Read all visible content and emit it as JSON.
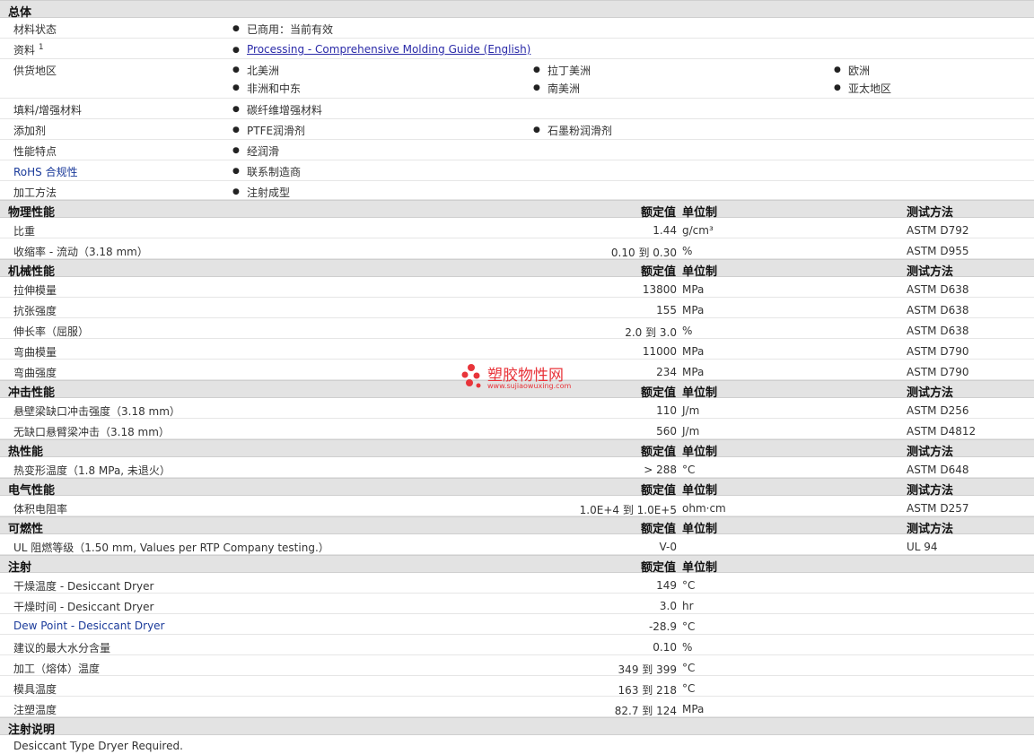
{
  "general": {
    "title": "总体",
    "material_status": {
      "label": "材料状态",
      "value": "已商用：当前有效"
    },
    "literature": {
      "label": "资料",
      "sup": "1",
      "link": "Processing - Comprehensive Molding Guide (English)"
    },
    "availability": {
      "label": "供货地区",
      "items": [
        "北美洲",
        "拉丁美洲",
        "欧洲",
        "非洲和中东",
        "南美洲",
        "亚太地区"
      ]
    },
    "filler": {
      "label": "填料/增强材料",
      "value": "碳纤维增强材料"
    },
    "additive": {
      "label": "添加剂",
      "items": [
        "PTFE润滑剂",
        "石墨粉润滑剂"
      ]
    },
    "features": {
      "label": "性能特点",
      "value": "经润滑"
    },
    "rohs": {
      "label": "RoHS 合规性",
      "value": "联系制造商"
    },
    "processing": {
      "label": "加工方法",
      "value": "注射成型"
    }
  },
  "columns": {
    "nominal": "额定值",
    "unit": "单位制",
    "test": "测试方法"
  },
  "sections": {
    "physical": {
      "title": "物理性能",
      "rows": [
        {
          "label": "比重",
          "value": "1.44",
          "unit": "g/cm³",
          "test": "ASTM D792"
        },
        {
          "label": "收缩率  - 流动（3.18 mm）",
          "value": "0.10 到  0.30",
          "unit": "%",
          "test": "ASTM D955"
        }
      ]
    },
    "mechanical": {
      "title": "机械性能",
      "rows": [
        {
          "label": "拉伸模量",
          "value": "13800",
          "unit": "MPa",
          "test": "ASTM D638"
        },
        {
          "label": "抗张强度",
          "value": "155",
          "unit": "MPa",
          "test": "ASTM D638"
        },
        {
          "label": "伸长率（屈服）",
          "value": "2.0 到  3.0",
          "unit": "%",
          "test": "ASTM D638"
        },
        {
          "label": "弯曲模量",
          "value": "11000",
          "unit": "MPa",
          "test": "ASTM D790"
        },
        {
          "label": "弯曲强度",
          "value": "234",
          "unit": "MPa",
          "test": "ASTM D790"
        }
      ]
    },
    "impact": {
      "title": "冲击性能",
      "rows": [
        {
          "label": "悬壁梁缺口冲击强度（3.18 mm）",
          "value": "110",
          "unit": "J/m",
          "test": "ASTM D256"
        },
        {
          "label": "无缺口悬臂梁冲击（3.18 mm）",
          "value": "560",
          "unit": "J/m",
          "test": "ASTM D4812"
        }
      ]
    },
    "thermal": {
      "title": "热性能",
      "rows": [
        {
          "label": "热变形温度（1.8 MPa, 未退火）",
          "value": "> 288",
          "unit": "°C",
          "test": "ASTM D648"
        }
      ]
    },
    "electrical": {
      "title": "电气性能",
      "rows": [
        {
          "label": "体积电阻率",
          "value": "1.0E+4 到  1.0E+5",
          "unit": "ohm·cm",
          "test": "ASTM D257"
        }
      ]
    },
    "flammability": {
      "title": "可燃性",
      "rows": [
        {
          "label": "UL 阻燃等级（1.50 mm, Values per RTP Company testing.）",
          "value": "V-0",
          "unit": "",
          "test": "UL 94"
        }
      ]
    },
    "injection": {
      "title": "注射",
      "rows": [
        {
          "label": "干燥温度  - Desiccant Dryer",
          "value": "149",
          "unit": "°C"
        },
        {
          "label": "干燥时间  - Desiccant Dryer",
          "value": "3.0",
          "unit": "hr"
        },
        {
          "label": "Dew Point - Desiccant Dryer",
          "value": "-28.9",
          "unit": "°C"
        },
        {
          "label": "建议的最大水分含量",
          "value": "0.10",
          "unit": "%"
        },
        {
          "label": "加工（熔体）温度",
          "value": "349 到  399",
          "unit": "°C"
        },
        {
          "label": "模具温度",
          "value": "163 到  218",
          "unit": "°C"
        },
        {
          "label": "注塑温度",
          "value": "82.7 到  124",
          "unit": "MPa"
        }
      ]
    },
    "injection_notes": {
      "title": "注射说明",
      "text": "Desiccant Type Dryer Required."
    }
  },
  "watermark": {
    "name": "塑胶物性网",
    "url": "www.sujiaowuxing.com"
  }
}
